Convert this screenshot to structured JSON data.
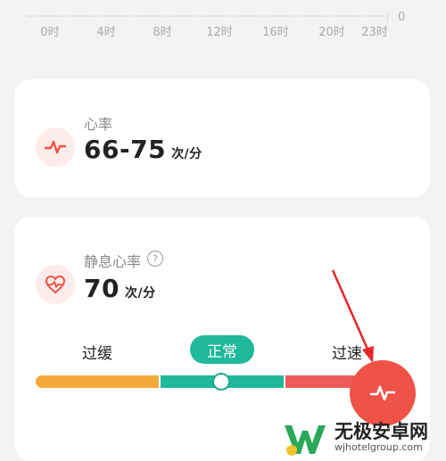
{
  "hourly_axis": {
    "ticks": [
      "0时",
      "4时",
      "8时",
      "12时",
      "16时",
      "20时",
      "23时"
    ],
    "zero_value": "0"
  },
  "heart_rate_card": {
    "title": "心率",
    "range_value": "66-75",
    "unit": "次/分",
    "icon": "heartbeat-icon"
  },
  "resting_card": {
    "title": "静息心率",
    "help": "?",
    "value": "70",
    "unit": "次/分",
    "icon": "heart-pulse-icon",
    "zones": {
      "slow": "过缓",
      "normal": "正常",
      "fast": "过速"
    },
    "indicator_level": 0.5,
    "colors": {
      "slow": "#f6a93b",
      "normal": "#1fb89a",
      "fast": "#ef5a5a"
    }
  },
  "fab": {
    "icon": "heartbeat-icon",
    "color": "#ef5246"
  },
  "watermark": {
    "title": "无极安卓网",
    "url": "wjhotelgroup.com"
  }
}
